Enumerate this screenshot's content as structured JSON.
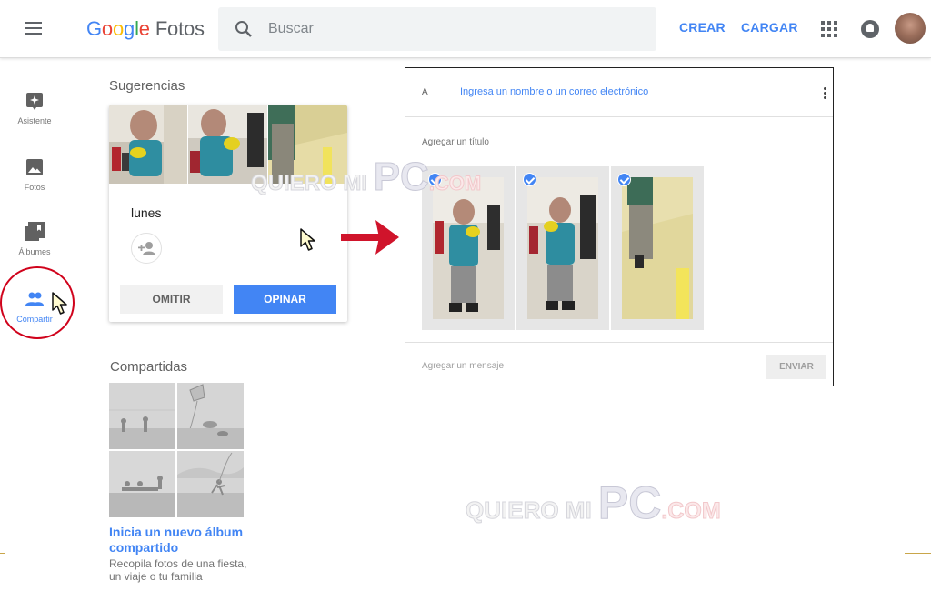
{
  "header": {
    "logo_google": [
      "G",
      "o",
      "o",
      "g",
      "l",
      "e"
    ],
    "logo_product": "Fotos",
    "search_placeholder": "Buscar",
    "create_label": "CREAR",
    "upload_label": "CARGAR"
  },
  "nav": {
    "items": [
      {
        "label": "Asistente",
        "icon": "assistant-icon"
      },
      {
        "label": "Fotos",
        "icon": "photo-icon"
      },
      {
        "label": "Álbumes",
        "icon": "albums-icon"
      },
      {
        "label": "Compartir",
        "icon": "share-people-icon",
        "active": true
      }
    ]
  },
  "suggestions": {
    "title": "Sugerencias",
    "day": "lunes",
    "omit_label": "OMITIR",
    "opinar_label": "OPINAR"
  },
  "share_panel": {
    "to_label": "A",
    "to_placeholder": "Ingresa un nombre o un correo electrónico",
    "title_placeholder": "Agregar un título",
    "message_placeholder": "Agregar un mensaje",
    "send_label": "ENVIAR",
    "selected_count": 3
  },
  "shared": {
    "title": "Compartidas",
    "new_album_link": "Inicia un nuevo álbum compartido",
    "new_album_desc": "Recopila fotos de una fiesta, un viaje o tu familia"
  },
  "watermark": {
    "part1": "QUIERO MI",
    "part2": "PC",
    "part3": ".COM"
  },
  "colors": {
    "accent": "#4285f4",
    "annotation_red": "#d0021b"
  }
}
